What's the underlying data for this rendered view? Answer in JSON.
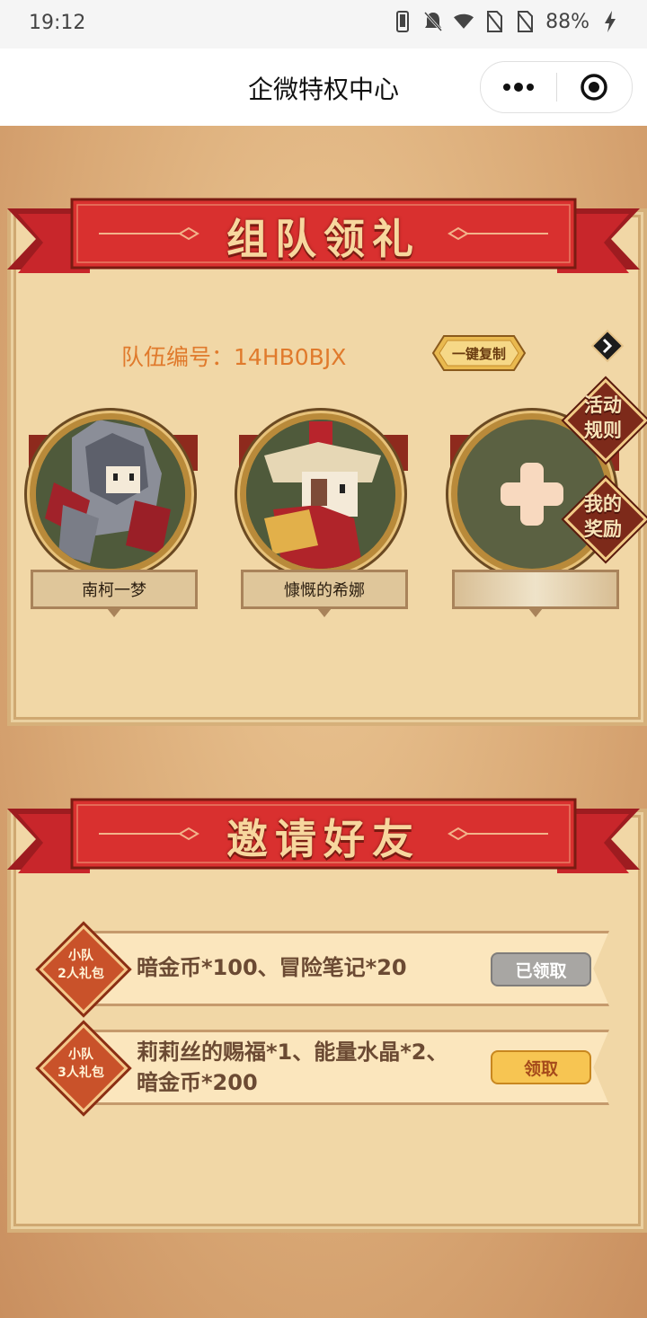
{
  "status_bar": {
    "time": "19:12",
    "battery": "88%"
  },
  "nav": {
    "title": "企微特权中心"
  },
  "team_section": {
    "banner_title": "组队领礼",
    "team_id_label": "队伍编号：",
    "team_id": "14HB0BJX",
    "copy_button": "一键复制",
    "members": [
      {
        "name": "南柯一梦",
        "avatar": "armored-knight-avatar"
      },
      {
        "name": "慷慨的希娜",
        "avatar": "red-warrior-avatar"
      },
      {
        "name": "",
        "avatar": "add-member-plus-icon"
      }
    ],
    "side_buttons": {
      "rules": "活动\n规则",
      "rules_line1": "活动",
      "rules_line2": "规则",
      "rewards_line1": "我的",
      "rewards_line2": "奖励"
    }
  },
  "invite_section": {
    "banner_title": "邀请好友",
    "rewards": [
      {
        "badge_line1": "小队",
        "badge_line2": "2人礼包",
        "text_line1": "暗金币*100、冒险笔记*20",
        "text_line2": "",
        "button": "已领取",
        "state": "claimed"
      },
      {
        "badge_line1": "小队",
        "badge_line2": "3人礼包",
        "text_line1": "莉莉丝的赐福*1、能量水晶*2、",
        "text_line2": "暗金币*200",
        "button": "领取",
        "state": "available"
      }
    ]
  },
  "colors": {
    "banner_red": "#c8262b",
    "panel": "#f1d7a6",
    "team_id_orange": "#e07a2c",
    "claimed_gray": "#a8a6a3",
    "claim_yellow": "#f7c552"
  }
}
